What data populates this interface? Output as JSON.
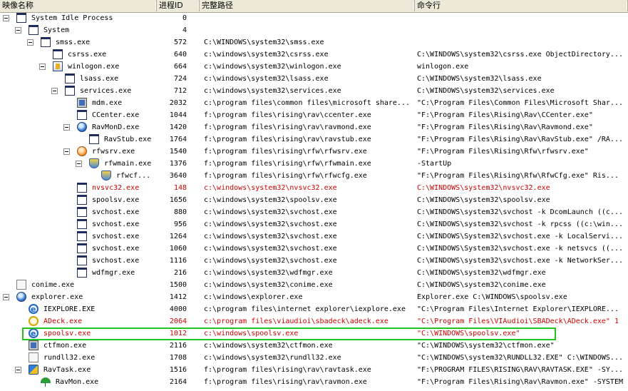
{
  "columns": {
    "name": "映像名称",
    "pid": "进程ID",
    "path": "完整路径",
    "cmd": "命令行"
  },
  "rows": [
    {
      "name": "System Idle Process",
      "pid": "0",
      "path": "",
      "cmd": "",
      "depth": 0,
      "expander": true,
      "icon": "window-icon",
      "red": false
    },
    {
      "name": "System",
      "pid": "4",
      "path": "",
      "cmd": "",
      "depth": 1,
      "expander": true,
      "icon": "window-icon",
      "red": false
    },
    {
      "name": "smss.exe",
      "pid": "572",
      "path": "C:\\WINDOWS\\system32\\smss.exe",
      "cmd": "",
      "depth": 2,
      "expander": true,
      "icon": "window-icon",
      "red": false
    },
    {
      "name": "csrss.exe",
      "pid": "640",
      "path": "c:\\windows\\system32\\csrss.exe",
      "cmd": "C:\\WINDOWS\\system32\\csrss.exe ObjectDirectory...",
      "depth": 3,
      "expander": false,
      "icon": "window-icon",
      "red": false
    },
    {
      "name": "winlogon.exe",
      "pid": "664",
      "path": "c:\\windows\\system32\\winlogon.exe",
      "cmd": "winlogon.exe",
      "depth": 3,
      "expander": true,
      "icon": "winlogon-icon",
      "red": false
    },
    {
      "name": "lsass.exe",
      "pid": "724",
      "path": "c:\\windows\\system32\\lsass.exe",
      "cmd": "C:\\WINDOWS\\system32\\lsass.exe",
      "depth": 4,
      "expander": false,
      "icon": "window-icon",
      "red": false
    },
    {
      "name": "services.exe",
      "pid": "712",
      "path": "c:\\windows\\system32\\services.exe",
      "cmd": "C:\\WINDOWS\\system32\\services.exe",
      "depth": 4,
      "expander": true,
      "icon": "window-icon",
      "red": false
    },
    {
      "name": "mdm.exe",
      "pid": "2032",
      "path": "c:\\program files\\common files\\microsoft share...",
      "cmd": "\"C:\\Program Files\\Common Files\\Microsoft Shar...",
      "depth": 5,
      "expander": false,
      "icon": "mdm-icon",
      "red": false
    },
    {
      "name": "CCenter.exe",
      "pid": "1044",
      "path": "f:\\program files\\rising\\rav\\ccenter.exe",
      "cmd": "\"F:\\Program Files\\Rising\\Rav\\CCenter.exe\"",
      "depth": 5,
      "expander": false,
      "icon": "window-icon",
      "red": false
    },
    {
      "name": "RavMonD.exe",
      "pid": "1420",
      "path": "f:\\program files\\rising\\rav\\ravmond.exe",
      "cmd": "\"F:\\Program Files\\Rising\\Rav\\Ravmond.exe\"",
      "depth": 5,
      "expander": true,
      "icon": "globe-icon",
      "red": false
    },
    {
      "name": "RavStub.exe",
      "pid": "1764",
      "path": "f:\\program files\\rising\\rav\\ravstub.exe",
      "cmd": "\"F:\\Program Files\\Rising\\Rav\\RavStub.exe\" /RA...",
      "depth": 6,
      "expander": false,
      "icon": "window-icon",
      "red": false
    },
    {
      "name": "rfwsrv.exe",
      "pid": "1540",
      "path": "f:\\program files\\rising\\rfw\\rfwsrv.exe",
      "cmd": "\"F:\\Program Files\\Rising\\Rfw\\rfwsrv.exe\"",
      "depth": 5,
      "expander": true,
      "icon": "firewall-icon",
      "red": false
    },
    {
      "name": "rfwmain.exe",
      "pid": "1376",
      "path": "f:\\program files\\rising\\rfw\\rfwmain.exe",
      "cmd": " -StartUp",
      "depth": 6,
      "expander": true,
      "icon": "shield-icon",
      "red": false
    },
    {
      "name": "rfwcf...",
      "pid": "3640",
      "path": "f:\\program files\\rising\\rfw\\rfwcfg.exe",
      "cmd": "\"F:\\Program Files\\Rising\\Rfw\\RfwCfg.exe\"  Ris...",
      "depth": 7,
      "expander": false,
      "icon": "shield-icon",
      "red": false
    },
    {
      "name": "nvsvc32.exe",
      "pid": "148",
      "path": "c:\\windows\\system32\\nvsvc32.exe",
      "cmd": "C:\\WINDOWS\\system32\\nvsvc32.exe",
      "depth": 5,
      "expander": false,
      "icon": "window-icon",
      "red": true
    },
    {
      "name": "spoolsv.exe",
      "pid": "1656",
      "path": "c:\\windows\\system32\\spoolsv.exe",
      "cmd": "C:\\WINDOWS\\system32\\spoolsv.exe",
      "depth": 5,
      "expander": false,
      "icon": "window-icon",
      "red": false
    },
    {
      "name": "svchost.exe",
      "pid": "880",
      "path": "c:\\windows\\system32\\svchost.exe",
      "cmd": "C:\\WINDOWS\\system32\\svchost -k DcomLaunch ((c...",
      "depth": 5,
      "expander": false,
      "icon": "window-icon",
      "red": false
    },
    {
      "name": "svchost.exe",
      "pid": "956",
      "path": "c:\\windows\\system32\\svchost.exe",
      "cmd": "C:\\WINDOWS\\system32\\svchost -k rpcss ((c:\\win...",
      "depth": 5,
      "expander": false,
      "icon": "window-icon",
      "red": false
    },
    {
      "name": "svchost.exe",
      "pid": "1264",
      "path": "c:\\windows\\system32\\svchost.exe",
      "cmd": "C:\\WINDOWS\\System32\\svchost.exe -k LocalServi...",
      "depth": 5,
      "expander": false,
      "icon": "window-icon",
      "red": false
    },
    {
      "name": "svchost.exe",
      "pid": "1060",
      "path": "c:\\windows\\system32\\svchost.exe",
      "cmd": "C:\\WINDOWS\\System32\\svchost.exe -k netsvcs ((...",
      "depth": 5,
      "expander": false,
      "icon": "window-icon",
      "red": false
    },
    {
      "name": "svchost.exe",
      "pid": "1116",
      "path": "c:\\windows\\system32\\svchost.exe",
      "cmd": "C:\\WINDOWS\\system32\\svchost.exe -k NetworkSer...",
      "depth": 5,
      "expander": false,
      "icon": "window-icon",
      "red": false
    },
    {
      "name": "wdfmgr.exe",
      "pid": "216",
      "path": "c:\\windows\\system32\\wdfmgr.exe",
      "cmd": "C:\\WINDOWS\\system32\\wdfmgr.exe",
      "depth": 5,
      "expander": false,
      "icon": "window-icon",
      "red": false
    },
    {
      "name": "conime.exe",
      "pid": "1500",
      "path": "c:\\windows\\system32\\conime.exe",
      "cmd": "C:\\WINDOWS\\system32\\conime.exe",
      "depth": 0,
      "expander": false,
      "icon": "blank-icon",
      "red": false
    },
    {
      "name": "explorer.exe",
      "pid": "1412",
      "path": "c:\\windows\\explorer.exe",
      "cmd": "Explorer.exe C:\\WINDOWS\\spoolsv.exe",
      "depth": 0,
      "expander": true,
      "icon": "globe-icon",
      "red": false
    },
    {
      "name": "IEXPLORE.EXE",
      "pid": "4000",
      "path": "c:\\program files\\internet explorer\\iexplore.exe",
      "cmd": "\"C:\\Program Files\\Internet Explorer\\IEXPLORE...",
      "depth": 1,
      "expander": false,
      "icon": "ie-icon",
      "red": false
    },
    {
      "name": "ADeck.exe",
      "pid": "2064",
      "path": "c:\\program files\\viaudioi\\sbadeck\\adeck.exe",
      "cmd": "\"C:\\Program Files\\VIAudioi\\SBADeck\\ADeck.exe\" 1",
      "depth": 1,
      "expander": false,
      "icon": "headset-icon",
      "red": true
    },
    {
      "name": "spoolsv.exe",
      "pid": "1012",
      "path": "c:\\windows\\spoolsv.exe",
      "cmd": "\"C:\\WINDOWS\\spoolsv.exe\"",
      "depth": 1,
      "expander": false,
      "icon": "ie-icon",
      "red": true
    },
    {
      "name": "ctfmon.exe",
      "pid": "2116",
      "path": "c:\\windows\\system32\\ctfmon.exe",
      "cmd": "\"C:\\WINDOWS\\system32\\ctfmon.exe\"",
      "depth": 1,
      "expander": false,
      "icon": "mdm-icon",
      "red": false
    },
    {
      "name": "rundll32.exe",
      "pid": "1708",
      "path": "c:\\windows\\system32\\rundll32.exe",
      "cmd": "\"C:\\WINDOWS\\system32\\RUNDLL32.EXE\" C:\\WINDOWS...",
      "depth": 1,
      "expander": false,
      "icon": "blank-icon",
      "red": false
    },
    {
      "name": "RavTask.exe",
      "pid": "1516",
      "path": "f:\\program files\\rising\\rav\\ravtask.exe",
      "cmd": "\"F:\\PROGRAM FILES\\RISING\\RAV\\RAVTASK.EXE\" -SY...",
      "depth": 1,
      "expander": true,
      "icon": "task-icon",
      "red": false
    },
    {
      "name": "RavMon.exe",
      "pid": "2164",
      "path": "f:\\program files\\rising\\rav\\ravmon.exe",
      "cmd": "\"F:\\Program Files\\Rising\\Rav\\Ravmon.exe\" -SYSTEM",
      "depth": 2,
      "expander": false,
      "icon": "umbrella-icon",
      "red": false
    }
  ],
  "highlighted_row": 26,
  "colors": {
    "header_bg": "#ece9d8",
    "red_text": "#cc0000",
    "highlight_border": "#22c422"
  }
}
